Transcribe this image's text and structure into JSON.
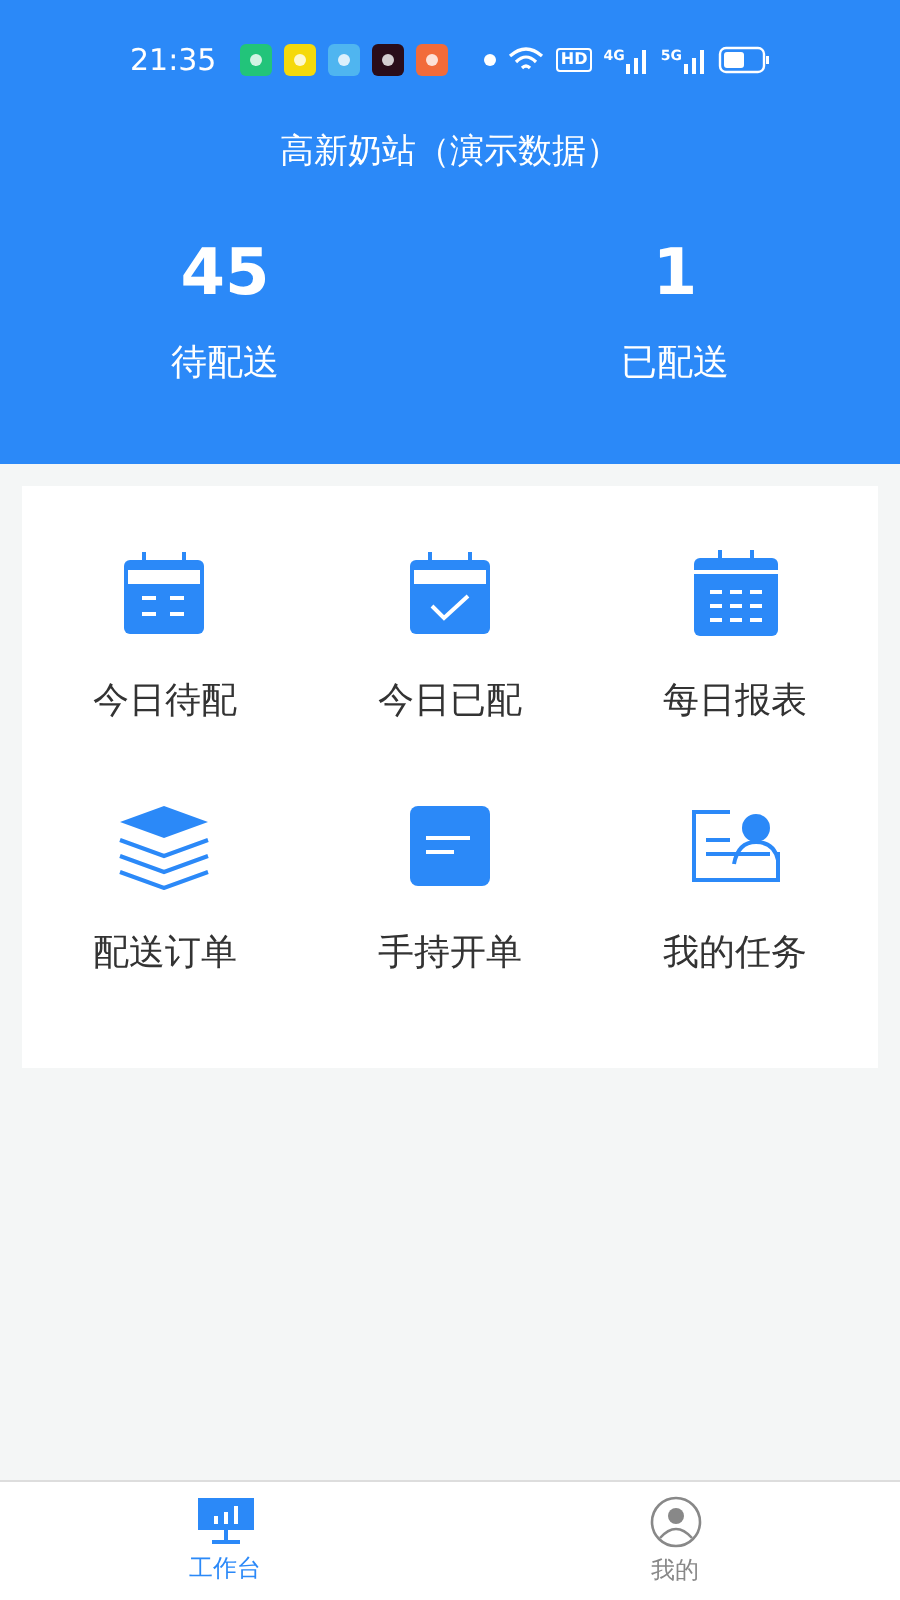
{
  "status_bar": {
    "time": "21:35",
    "network_labels": [
      "HD",
      "4G",
      "5G"
    ]
  },
  "header": {
    "title": "高新奶站（演示数据）"
  },
  "stats": [
    {
      "value": "45",
      "label": "待配送"
    },
    {
      "value": "1",
      "label": "已配送"
    }
  ],
  "menu": [
    {
      "kind": "calendar-list",
      "label": "今日待配"
    },
    {
      "kind": "calendar-check",
      "label": "今日已配"
    },
    {
      "kind": "calendar-grid",
      "label": "每日报表"
    },
    {
      "kind": "layers",
      "label": "配送订单"
    },
    {
      "kind": "note",
      "label": "手持开单"
    },
    {
      "kind": "profile-card",
      "label": "我的任务"
    }
  ],
  "tabs": [
    {
      "kind": "workbench",
      "label": "工作台",
      "selected": true
    },
    {
      "kind": "user",
      "label": "我的",
      "selected": false
    }
  ]
}
